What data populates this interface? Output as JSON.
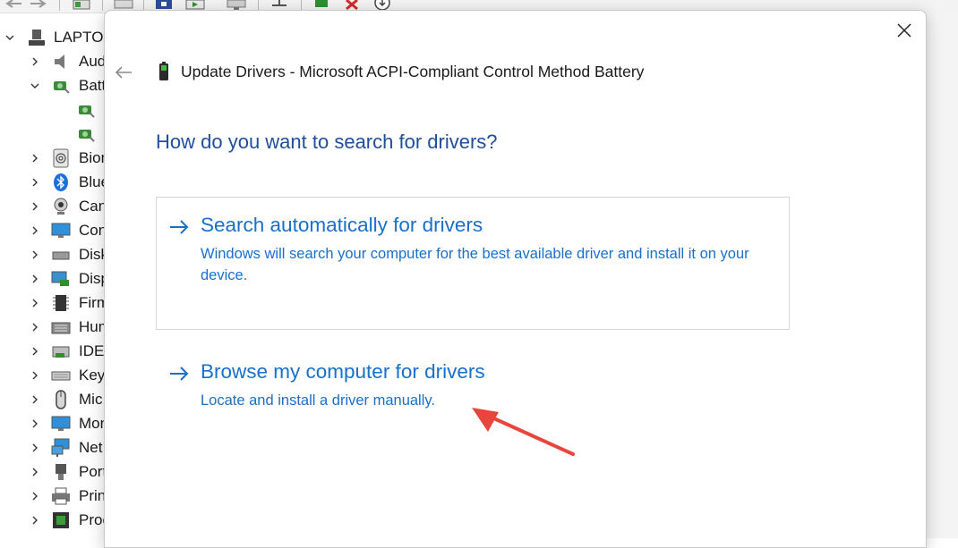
{
  "dialog": {
    "title": "Update Drivers - Microsoft ACPI-Compliant Control Method Battery",
    "question": "How do you want to search for drivers?",
    "options": [
      {
        "title": "Search automatically for drivers",
        "description": "Windows will search your computer for the best available driver and install it on your device."
      },
      {
        "title": "Browse my computer for drivers",
        "description": "Locate and install a driver manually."
      }
    ],
    "icons": {
      "close": "close-icon",
      "back": "back-arrow-icon",
      "device": "battery-icon",
      "option_arrow": "arrow-right-icon"
    }
  },
  "device_manager": {
    "root": "LAPTOP",
    "categories": [
      "Aud",
      "Batt",
      "",
      "",
      "Bion",
      "Blue",
      "Can",
      "Con",
      "Disk",
      "Disp",
      "Firm",
      "Hum",
      "IDE",
      "Key",
      "Mic",
      "Mon",
      "Net",
      "Port",
      "Prin",
      "Proc"
    ]
  },
  "colors": {
    "question": "#1f4e9b",
    "option_text": "#1a6fc9",
    "annotation_arrow": "#e8453c",
    "option_border": "#d6d6d6"
  },
  "annotation": {
    "type": "red-arrow",
    "points_to": "Browse my computer for drivers"
  }
}
